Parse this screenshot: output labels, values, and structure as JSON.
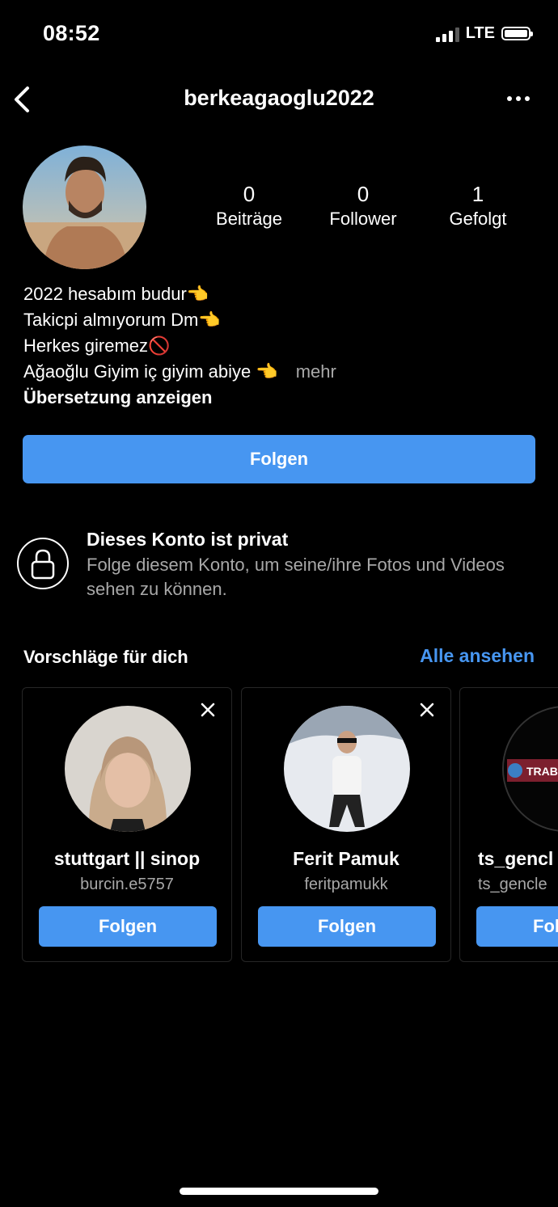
{
  "status_bar": {
    "time": "08:52",
    "network": "LTE",
    "signal_icon": "signal-bars-icon",
    "battery_icon": "battery-icon"
  },
  "header": {
    "username": "berkeagaoglu2022",
    "back_icon": "chevron-left-icon",
    "more_icon": "more-horizontal-icon"
  },
  "profile": {
    "stats": [
      {
        "value": "0",
        "label": "Beiträge"
      },
      {
        "value": "0",
        "label": "Follower"
      },
      {
        "value": "1",
        "label": "Gefolgt"
      }
    ],
    "bio_lines": [
      "2022 hesabım budur👈",
      "Takicpi almıyorum Dm👈",
      "Herkes giremez🚫",
      "Ağaoğlu Giyim iç giyim abiye 👈"
    ],
    "more_label": "mehr",
    "translate_label": "Übersetzung anzeigen",
    "follow_label": "Folgen"
  },
  "private": {
    "title": "Dieses Konto ist privat",
    "description": "Folge diesem Konto, um seine/ihre Fotos und Videos sehen zu können.",
    "icon": "lock-icon"
  },
  "suggestions": {
    "title": "Vorschläge für dich",
    "see_all_label": "Alle ansehen",
    "cards": [
      {
        "name": "stuttgart || sinop",
        "handle": "burcin.e5757",
        "button": "Folgen"
      },
      {
        "name": "Ferit Pamuk",
        "handle": "feritpamukk",
        "button": "Folgen"
      },
      {
        "name": "ts_gencl",
        "handle": "ts_gencle",
        "button": "Fol",
        "badge": "TRABZ"
      }
    ]
  },
  "colors": {
    "accent": "#4796f1",
    "background": "#000000",
    "secondary_text": "#a8a8a8"
  }
}
